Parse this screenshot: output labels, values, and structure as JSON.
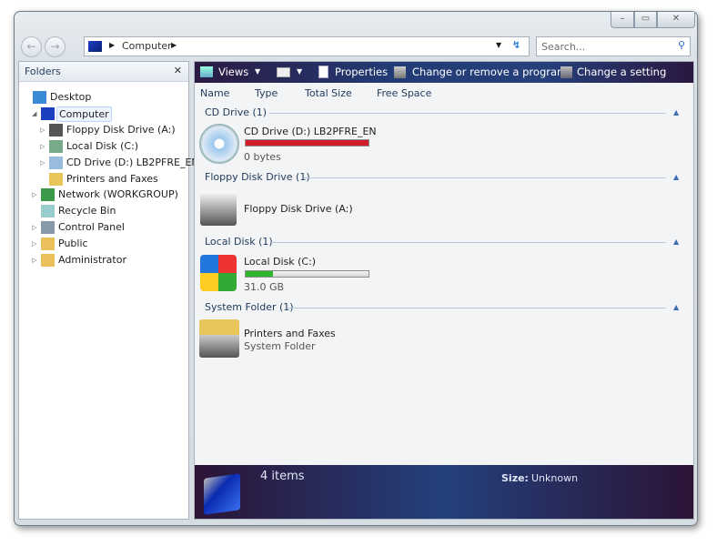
{
  "window": {
    "minimize": "▭",
    "maximize": "▭",
    "close": "✕"
  },
  "nav": {
    "back": "back",
    "forward": "forward",
    "breadcrumb": "Computer",
    "search_placeholder": "Search..."
  },
  "folders": {
    "title": "Folders",
    "close": "✕",
    "items": [
      {
        "label": "Desktop",
        "icon": "desktop-icon",
        "level": 0,
        "expander": ""
      },
      {
        "label": "Computer",
        "icon": "computer-icon",
        "level": 1,
        "expander": "◢",
        "selected": true
      },
      {
        "label": "Floppy Disk Drive (A:)",
        "icon": "floppy-icon",
        "level": 2,
        "expander": "▷"
      },
      {
        "label": "Local Disk (C:)",
        "icon": "disk-icon",
        "level": 2,
        "expander": "▷"
      },
      {
        "label": "CD Drive (D:) LB2PFRE_EN",
        "icon": "cd-icon",
        "level": 2,
        "expander": "▷"
      },
      {
        "label": "Printers and Faxes",
        "icon": "printer-icon",
        "level": 2,
        "expander": ""
      },
      {
        "label": "Network (WORKGROUP)",
        "icon": "network-icon",
        "level": 1,
        "expander": "▷"
      },
      {
        "label": "Recycle Bin",
        "icon": "recycle-bin-icon",
        "level": 1,
        "expander": ""
      },
      {
        "label": "Control Panel",
        "icon": "control-panel-icon",
        "level": 1,
        "expander": "▷"
      },
      {
        "label": "Public",
        "icon": "folder-icon",
        "level": 1,
        "expander": "▷"
      },
      {
        "label": "Administrator",
        "icon": "folder-icon",
        "level": 1,
        "expander": "▷"
      }
    ]
  },
  "toolbar": {
    "views": "Views",
    "properties": "Properties",
    "change_program": "Change or remove a program",
    "change_setting": "Change a setting"
  },
  "columns": [
    "Name",
    "Type",
    "Total Size",
    "Free Space"
  ],
  "groups": [
    {
      "header": "CD Drive (1)",
      "name": "CD Drive (D:) LB2PFRE_EN",
      "detail": "0 bytes",
      "usage": 1.0,
      "bar_color": "#d21d2a"
    },
    {
      "header": "Floppy Disk Drive (1)",
      "name": "Floppy Disk Drive (A:)"
    },
    {
      "header": "Local Disk (1)",
      "name": "Local Disk (C:)",
      "detail": "31.0 GB",
      "usage": 0.22,
      "bar_color": "#2fb62f"
    },
    {
      "header": "System Folder (1)",
      "name": "Printers and Faxes",
      "detail": "System Folder"
    }
  ],
  "status": {
    "count": "4 items",
    "size_label": "Size:",
    "size_value": "Unknown"
  }
}
